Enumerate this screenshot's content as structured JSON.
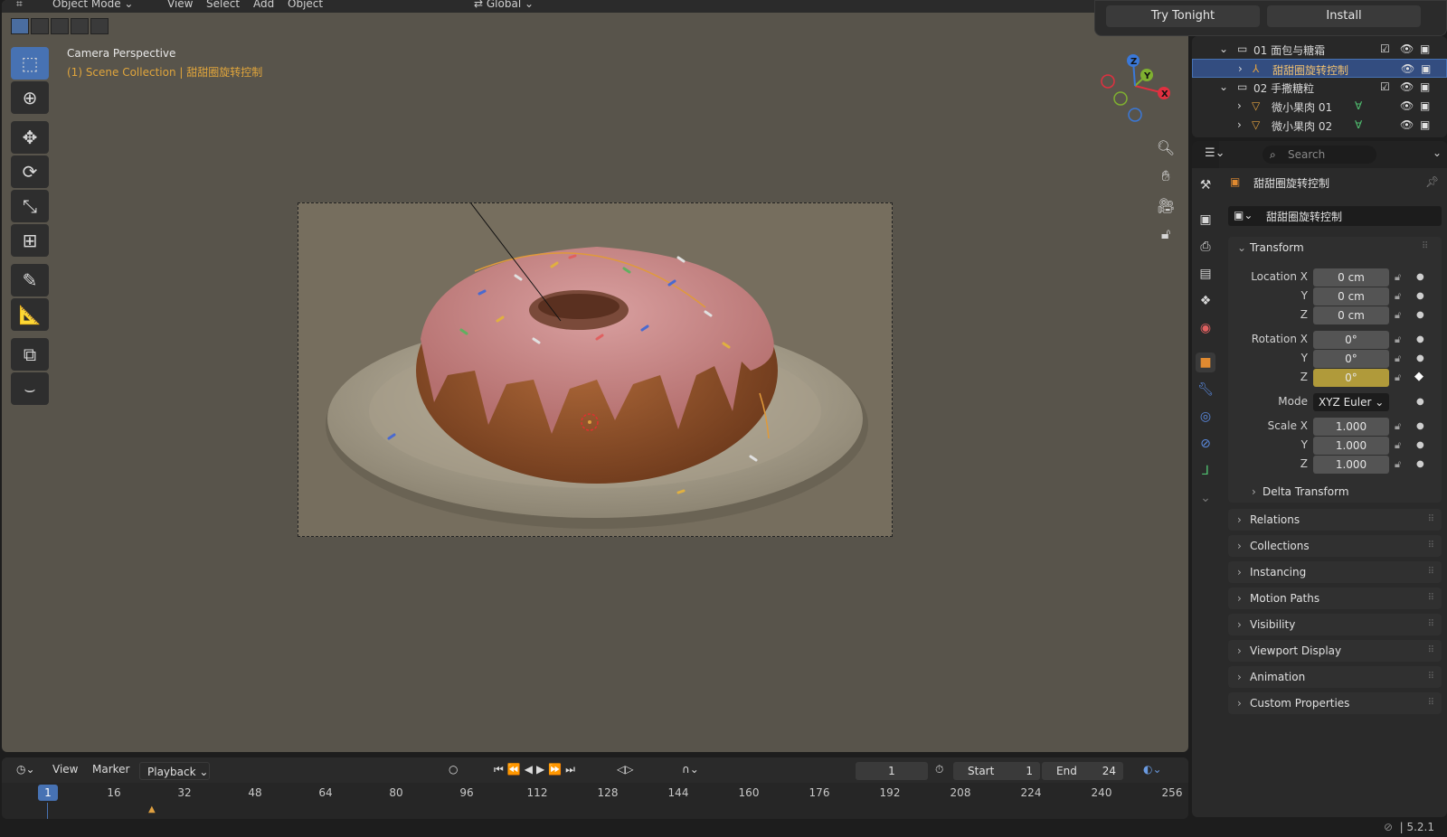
{
  "viewport": {
    "header": {
      "mode": "Object Mode",
      "menus": [
        "View",
        "Select",
        "Add",
        "Object"
      ],
      "transform_orientation": "Global"
    },
    "camera_label": "Camera Perspective",
    "scene_label": "(1) Scene Collection | 甜甜圈旋转控制"
  },
  "notification": {
    "try_label": "Try Tonight",
    "install_label": "Install"
  },
  "outliner": {
    "rows": [
      {
        "label": "01 面包与糖霜",
        "type": "collection"
      },
      {
        "label": "甜甜圈旋转控制",
        "type": "empty",
        "selected": true
      },
      {
        "label": "02 手撒糖粒",
        "type": "collection"
      },
      {
        "label": "微小果肉 01",
        "type": "mesh"
      },
      {
        "label": "微小果肉 02",
        "type": "mesh"
      }
    ]
  },
  "properties": {
    "search_placeholder": "Search",
    "object_name": "甜甜圈旋转控制",
    "datablock_name": "甜甜圈旋转控制",
    "transform": {
      "title": "Transform",
      "location_label": "Location X",
      "rotation_label": "Rotation X",
      "scale_label": "Scale X",
      "axis_y": "Y",
      "axis_z": "Z",
      "location": [
        "0 cm",
        "0 cm",
        "0 cm"
      ],
      "rotation": [
        "0°",
        "0°",
        "0°"
      ],
      "mode_label": "Mode",
      "mode_value": "XYZ Euler",
      "scale": [
        "1.000",
        "1.000",
        "1.000"
      ],
      "delta": "Delta Transform"
    },
    "panels": [
      "Relations",
      "Collections",
      "Instancing",
      "Motion Paths",
      "Visibility",
      "Viewport Display",
      "Animation",
      "Custom Properties"
    ]
  },
  "timeline": {
    "menus": [
      "View",
      "Marker",
      "Playback"
    ],
    "current_frame": "1",
    "start_label": "Start",
    "start_value": "1",
    "end_label": "End",
    "end_value": "24",
    "ticks": [
      "1",
      "16",
      "32",
      "48",
      "64",
      "80",
      "96",
      "112",
      "128",
      "144",
      "160",
      "176",
      "192",
      "208",
      "224",
      "240",
      "256"
    ]
  },
  "status": {
    "version": "5.2.1"
  },
  "colors": {
    "accent": "#4772b3",
    "viewport_bg": "#58544b",
    "animated_field": "#b09a3a"
  }
}
